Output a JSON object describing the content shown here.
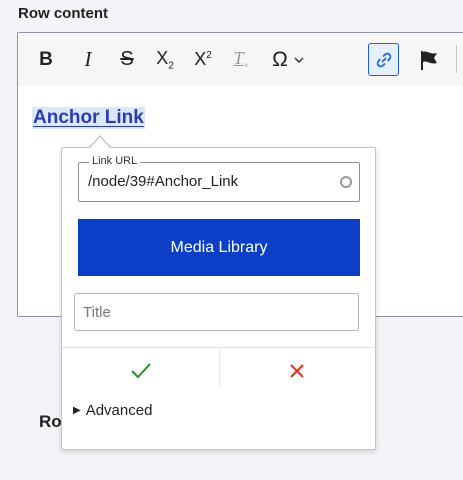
{
  "field": {
    "label": "Row content"
  },
  "toolbar": {
    "buttons": [
      {
        "name": "bold",
        "glyph": "B"
      },
      {
        "name": "italic",
        "glyph": "I"
      },
      {
        "name": "strikethrough",
        "glyph": "S"
      },
      {
        "name": "subscript",
        "glyph": "X"
      },
      {
        "name": "superscript",
        "glyph": "X"
      },
      {
        "name": "remove-format",
        "glyph": "T"
      },
      {
        "name": "special-characters",
        "glyph": "Ω"
      },
      {
        "name": "link",
        "active": true
      },
      {
        "name": "anchor"
      }
    ]
  },
  "content": {
    "anchor_text": "Anchor Link",
    "row_label_partial": "Ro"
  },
  "link_balloon": {
    "url_label": "Link URL",
    "url_value": "/node/39#Anchor_Link",
    "media_library_label": "Media Library",
    "title_placeholder": "Title",
    "advanced_label": "Advanced"
  },
  "colors": {
    "accent": "#0b3fc6",
    "link_text": "#2b3bb0",
    "save": "#2e8b3a",
    "cancel": "#e0321e"
  }
}
